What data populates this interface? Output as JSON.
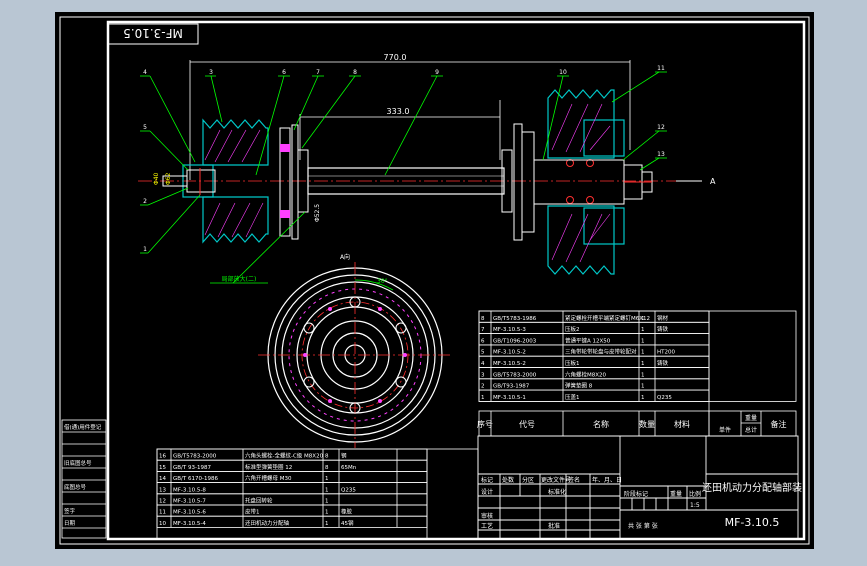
{
  "drawing": {
    "stamp": "MF-3.10.5",
    "dim_overall": "770.0",
    "dim_mid": "333.0",
    "section_mark": "A",
    "view_label": "A向",
    "angle_label": "30°",
    "note_label": "局部放大(二)",
    "left_dims": [
      "Φ40",
      "Φ62"
    ],
    "mid_dim": "Φ52.5",
    "balloons": [
      "4",
      "3",
      "6",
      "7",
      "8",
      "9",
      "5",
      "2",
      "1",
      "10",
      "11",
      "12",
      "13"
    ]
  },
  "colors": {
    "canvas": "#000000",
    "outside": "#b9c6d3",
    "line": "#ffffff",
    "part": "#00c8c8",
    "hatch": "#ff40ff",
    "center": "#ff3030",
    "leader": "#00ff00",
    "yellow": "#ffff00",
    "text": "#ffffff"
  },
  "bom_right": {
    "rows": [
      [
        "8",
        "GB/T5783-1986",
        "紧定螺栓开槽平端紧定螺钉M6X12",
        "1",
        "钢材"
      ],
      [
        "7",
        "MF-3.10.5-3",
        "压板2",
        "1",
        "铸铁"
      ],
      [
        "6",
        "GB/T1096-2003",
        "普通平键A 12X50",
        "1",
        ""
      ],
      [
        "5",
        "MF-3.10.5-2",
        "三角带轮带轮盘与皮带轮配对",
        "1",
        "HT200"
      ],
      [
        "4",
        "MF-3.10.5-2",
        "压板1",
        "1",
        "铸铁"
      ],
      [
        "3",
        "GB/T5783-2000",
        "六角螺栓M8X20",
        "1",
        ""
      ],
      [
        "2",
        "GB/T93-1987",
        "弹簧垫圈 8",
        "1",
        ""
      ],
      [
        "1",
        "MF-3.10.5-1",
        "压盖1",
        "1",
        "Q235"
      ]
    ],
    "header": [
      "序号",
      "代号",
      "名称",
      "数量",
      "材料",
      "单件",
      "总计",
      "备注"
    ],
    "header_weight": "重量"
  },
  "bom_left": {
    "rows": [
      [
        "16",
        "GB/T5783-2000",
        "六角头螺栓-全螺纹-C级 M8X20",
        "8",
        "钢"
      ],
      [
        "15",
        "GB/T 93-1987",
        "标准型弹簧垫圈 12",
        "8",
        "65Mn"
      ],
      [
        "14",
        "GB/T 6170-1986",
        "六角开槽螺母 M30",
        "1",
        ""
      ],
      [
        "13",
        "MF-3.10.5-8",
        "",
        "1",
        "Q235"
      ],
      [
        "12",
        "MF-3.10.5-7",
        "托盘回转轮",
        "1",
        ""
      ],
      [
        "11",
        "MF-3.10.5-6",
        "皮带1",
        "1",
        "橡胶"
      ],
      [
        "10",
        "MF-3.10.5-4",
        "还田机动力分配轴",
        "1",
        "45钢"
      ]
    ]
  },
  "title_block": {
    "name": "还田机动力分配轴部装",
    "code": "MF-3.10.5",
    "scale": "1:5",
    "labels": {
      "mark": "标记",
      "count": "处数",
      "zone": "分区",
      "doc": "更改文件号",
      "sign": "签名",
      "date": "年、月、日",
      "design": "设计",
      "standard": "标准化",
      "stage": "阶段标记",
      "weight": "重量",
      "ratio": "比例",
      "review": "审核",
      "process": "工艺",
      "approve": "批准",
      "sheets": "共  张  第  张"
    }
  },
  "side_strip": {
    "labels": [
      "借(通)用件登记",
      "旧底图总号",
      "底图总号",
      "签字",
      "日期"
    ]
  }
}
